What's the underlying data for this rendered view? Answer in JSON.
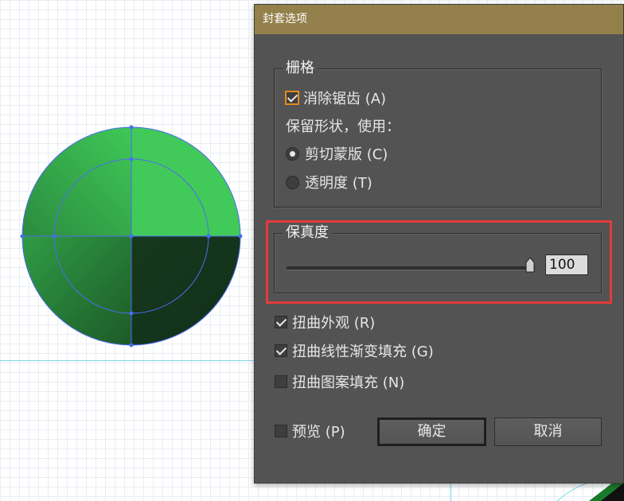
{
  "dialog": {
    "title": "封套选项",
    "raster_group": {
      "title": "栅格",
      "antialias_label": "消除锯齿 (A)",
      "antialias_checked": true,
      "preserve_shape_label": "保留形状，使用：",
      "clip_mask_label": "剪切蒙版 (C)",
      "clip_mask_selected": true,
      "transparency_label": "透明度 (T)",
      "transparency_selected": false
    },
    "fidelity_group": {
      "title": "保真度",
      "value": "100",
      "slider_fraction": 1.0
    },
    "distort_appearance_label": "扭曲外观 (R)",
    "distort_appearance_checked": true,
    "distort_linear_gradient_label": "扭曲线性渐变填充 (G)",
    "distort_linear_gradient_checked": true,
    "distort_pattern_label": "扭曲图案填充 (N)",
    "distort_pattern_checked": false,
    "preview_label": "预览 (P)",
    "preview_checked": false,
    "ok_label": "确定",
    "cancel_label": "取消"
  },
  "colors": {
    "titlebar": "#93804b",
    "dialog_bg": "#535353",
    "highlight": "#e33b3b",
    "circle_light": "#3fc857",
    "circle_dark": "#15301a",
    "selection_blue": "#4b6df0"
  }
}
